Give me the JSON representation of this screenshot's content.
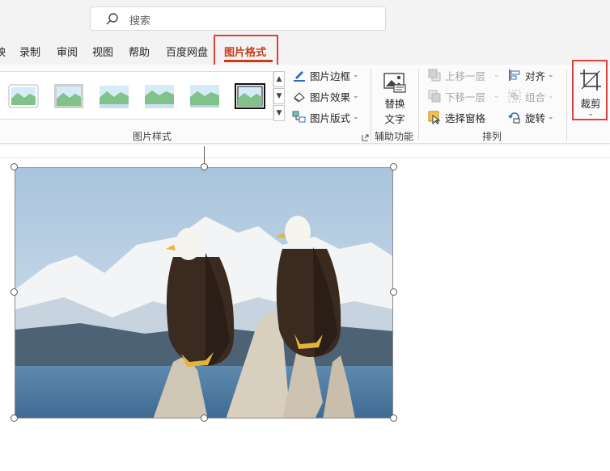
{
  "search": {
    "placeholder": "搜索"
  },
  "tabs": [
    {
      "label": "映"
    },
    {
      "label": "录制"
    },
    {
      "label": "审阅"
    },
    {
      "label": "视图"
    },
    {
      "label": "帮助"
    },
    {
      "label": "百度网盘"
    },
    {
      "label": "图片格式"
    }
  ],
  "active_tab": "图片格式",
  "picture_styles": {
    "group_label": "图片样式",
    "border_label": "图片边框",
    "effects_label": "图片效果",
    "layout_label": "图片版式"
  },
  "accessibility": {
    "group_label": "辅助功能",
    "alt_text_line1": "替换",
    "alt_text_line2": "文字"
  },
  "arrange": {
    "group_label": "排列",
    "bring_forward": "上移一层",
    "send_backward": "下移一层",
    "selection_pane": "选择窗格",
    "align": "对齐",
    "group": "组合",
    "rotate": "旋转"
  },
  "size": {
    "crop_label": "裁剪"
  },
  "colors": {
    "accent": "#c43e1c",
    "highlight_box": "#e0413a"
  }
}
